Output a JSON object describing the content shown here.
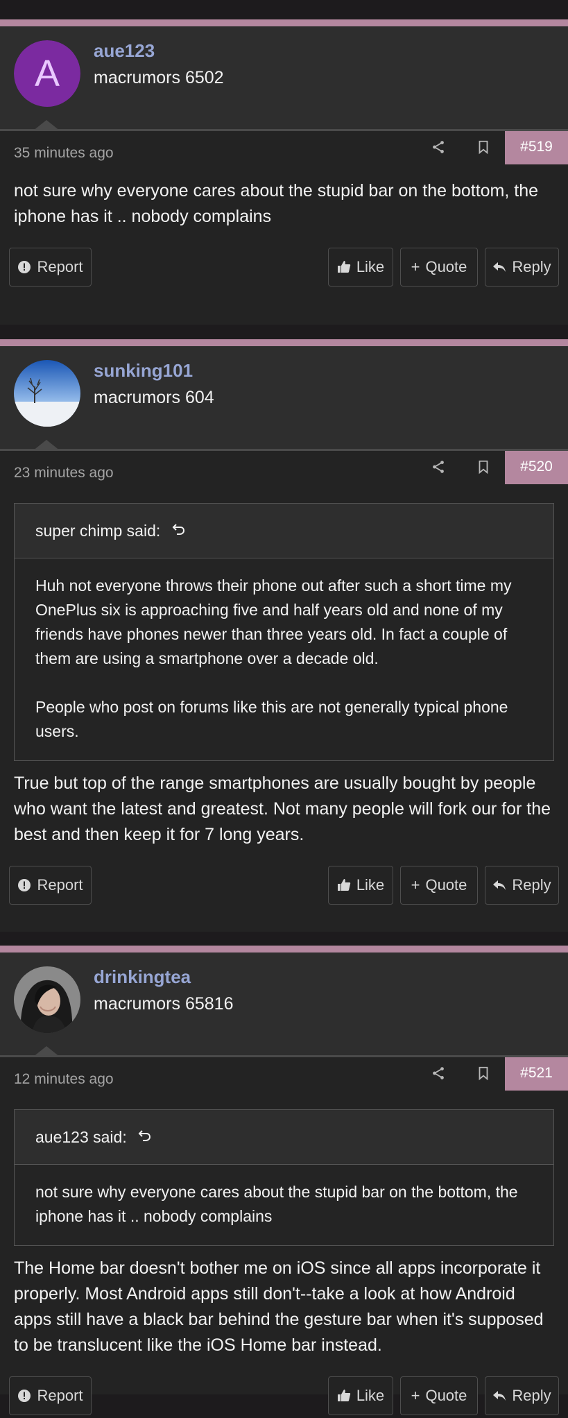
{
  "actions": {
    "report_label": "Report",
    "like_label": "Like",
    "quote_label": "Quote",
    "reply_label": "Reply"
  },
  "colors": {
    "accent": "#b4879f",
    "username": "#97a6d4",
    "avatar_letter_bg": "#7b2aa0"
  },
  "posts": [
    {
      "username": "aue123",
      "user_title": "macrumors 6502",
      "avatar_letter": "A",
      "timestamp": "35 minutes ago",
      "post_number": "#519",
      "body": "not sure why everyone cares about the stupid bar on the bottom, the iphone has it .. nobody complains"
    },
    {
      "username": "sunking101",
      "user_title": "macrumors 604",
      "avatar_icon": "snowy-tree-photo",
      "timestamp": "23 minutes ago",
      "post_number": "#520",
      "quote": {
        "author_said": "super chimp said:",
        "paragraphs": [
          "Huh not everyone throws their phone out after such a short time my OnePlus six is approaching five and half years old and none of my friends have phones newer than three years old. In fact a couple of them are using a smartphone over a decade old.",
          "People who post on forums like this are not generally typical phone users."
        ]
      },
      "body": "True but top of the range smartphones are usually bought by people who want the latest and greatest. Not many people will fork our for the best and then keep it for 7 long years."
    },
    {
      "username": "drinkingtea",
      "user_title": "macrumors 65816",
      "avatar_icon": "portrait-photo",
      "timestamp": "12 minutes ago",
      "post_number": "#521",
      "quote": {
        "author_said": "aue123 said:",
        "paragraphs": [
          "not sure why everyone cares about the stupid bar on the bottom, the iphone has it .. nobody complains"
        ]
      },
      "body": "The Home bar doesn't bother me on iOS since all apps incorporate it properly. Most Android apps still don't--take a look at how Android apps still have a black bar behind the gesture bar when it's supposed to be translucent like the iOS Home bar instead."
    }
  ]
}
